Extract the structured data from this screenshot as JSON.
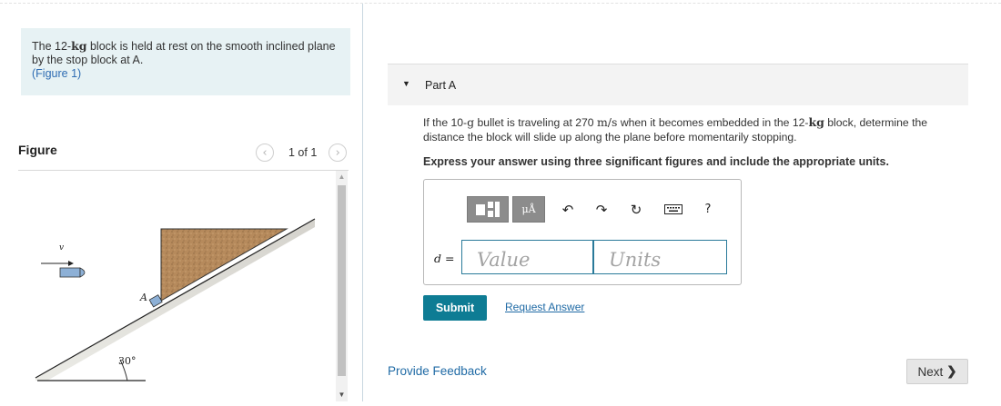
{
  "problem": {
    "text_before": "The 12-",
    "unit": "kg",
    "text_after": " block is held at rest on the smooth inclined plane by the stop block at A.",
    "figure_link": "(Figure 1)"
  },
  "figure_panel": {
    "title": "Figure",
    "pager_text": "1 of 1",
    "prev_icon": "chevron-left-icon",
    "next_icon": "chevron-right-icon",
    "labels": {
      "velocity": "v",
      "stop": "A",
      "angle": "30°"
    }
  },
  "part": {
    "title": "Part A",
    "question": {
      "t1": "If the 10-",
      "u1": "g",
      "t2": " bullet is traveling at 270 ",
      "u2": "m/s",
      "t3": " when it becomes embedded in the 12-",
      "u3": "kg",
      "t4": " block, determine the distance the block will slide up along the plane before momentarily stopping."
    },
    "instruction": "Express your answer using three significant figures and include the appropriate units.",
    "toolbar": {
      "templates_icon": "templates-icon",
      "units_label": "μÅ",
      "undo_icon": "undo-icon",
      "redo_icon": "redo-icon",
      "reset_icon": "reset-icon",
      "keyboard_icon": "keyboard-icon",
      "help_label": "?"
    },
    "answer": {
      "variable": "d",
      "equals": " =",
      "value_placeholder": "Value",
      "units_placeholder": "Units"
    },
    "submit_label": "Submit",
    "request_label": "Request Answer"
  },
  "feedback_label": "Provide Feedback",
  "next_label": "Next"
}
